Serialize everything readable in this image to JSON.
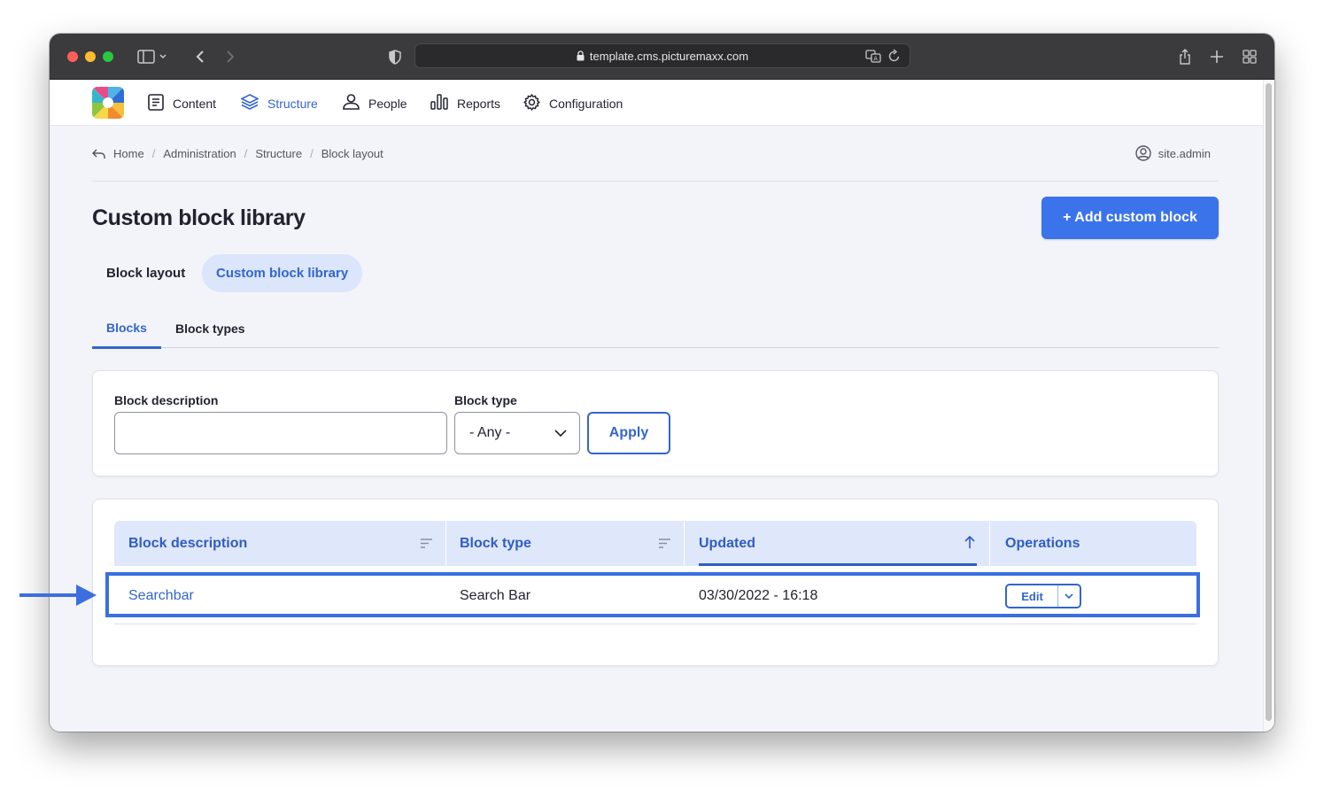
{
  "browser": {
    "url": "template.cms.picturemaxx.com"
  },
  "nav": {
    "items": [
      {
        "label": "Content",
        "icon": "content-icon"
      },
      {
        "label": "Structure",
        "icon": "structure-icon"
      },
      {
        "label": "People",
        "icon": "people-icon"
      },
      {
        "label": "Reports",
        "icon": "reports-icon"
      },
      {
        "label": "Configuration",
        "icon": "configuration-icon"
      }
    ],
    "active": "Structure"
  },
  "breadcrumb": [
    "Home",
    "Administration",
    "Structure",
    "Block layout"
  ],
  "user": {
    "name": "site.admin"
  },
  "page": {
    "title": "Custom block library",
    "add_button": "+ Add custom block"
  },
  "primary_tabs": [
    {
      "label": "Block layout",
      "active": false
    },
    {
      "label": "Custom block library",
      "active": true
    }
  ],
  "secondary_tabs": [
    {
      "label": "Blocks",
      "active": true
    },
    {
      "label": "Block types",
      "active": false
    }
  ],
  "filters": {
    "description_label": "Block description",
    "description_value": "",
    "type_label": "Block type",
    "type_value": "- Any -",
    "apply_label": "Apply"
  },
  "table": {
    "headers": [
      "Block description",
      "Block type",
      "Updated",
      "Operations"
    ],
    "sorted_by": "Updated",
    "rows": [
      {
        "description": "Searchbar",
        "type": "Search Bar",
        "updated": "03/30/2022 - 16:18",
        "operation": "Edit"
      }
    ]
  },
  "colors": {
    "accent": "#3366cc",
    "button": "#3b73ea",
    "highlight": "#3b6fe0"
  }
}
